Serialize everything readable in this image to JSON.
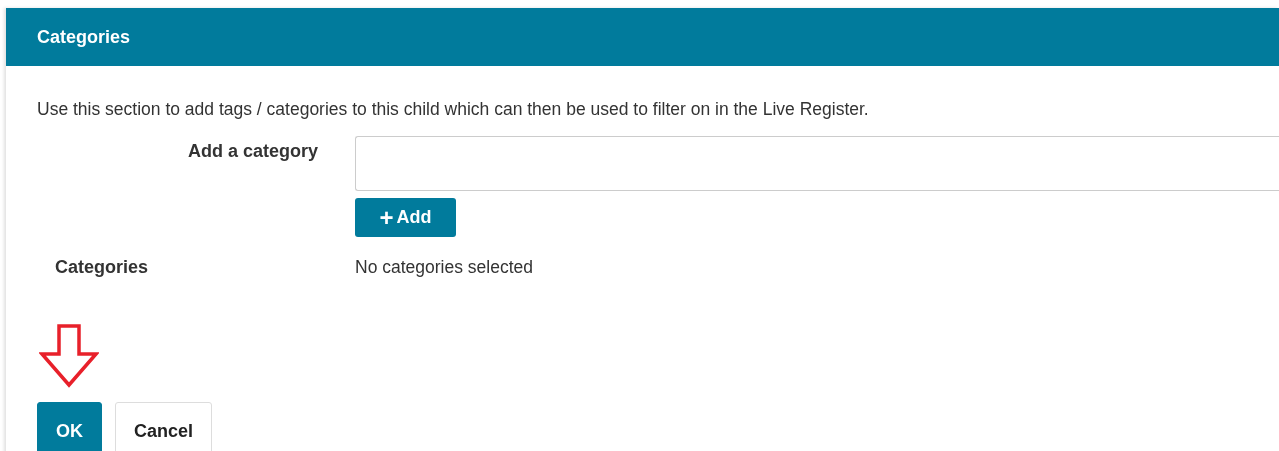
{
  "dialog": {
    "title": "Categories"
  },
  "intro": "Use this section to add tags / categories to this child which can then be used to filter on in the Live Register.",
  "add_category": {
    "label": "Add a category",
    "add_button": {
      "icon": "+",
      "label": "Add"
    }
  },
  "categories": {
    "label": "Categories",
    "value": "No categories selected"
  },
  "buttons": [
    {
      "label": "OK",
      "kind": "primary"
    },
    {
      "label": "Cancel",
      "kind": "default"
    }
  ]
}
